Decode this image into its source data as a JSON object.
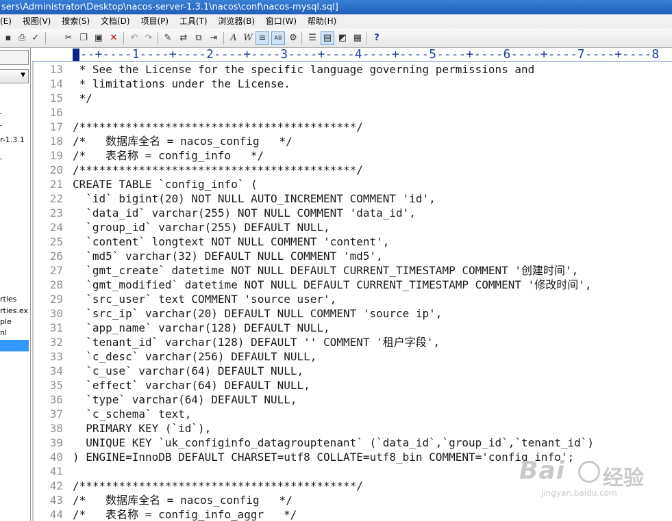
{
  "window": {
    "title": "sers\\Administrator\\Desktop\\nacos-server-1.3.1\\nacos\\conf\\nacos-mysql.sql]"
  },
  "menubar": {
    "items": [
      "(E)",
      "视图(V)",
      "搜索(S)",
      "文档(D)",
      "项目(P)",
      "工具(T)",
      "浏览器(B)",
      "窗口(W)",
      "帮助(H)"
    ]
  },
  "toolbar": {
    "icons": [
      "save-icon",
      "print-icon",
      "spellcheck-icon",
      "cut-icon",
      "copy-icon",
      "paste-icon",
      "delete-icon",
      "undo-icon",
      "redo-icon",
      "highlight-icon",
      "replace-icon",
      "copy-format-icon",
      "indent-icon",
      "font-icon",
      "word-wrap-icon",
      "line-numbers-icon",
      "case-icon",
      "settings-icon",
      "view-list-icon",
      "view-panel-icon",
      "view-output-icon",
      "view-browser-icon",
      "help-icon"
    ],
    "active": [
      "line-numbers-icon",
      "case-icon"
    ]
  },
  "sidebar": {
    "partial_labels": [
      "r-1.3.1",
      "rties",
      "rties.ex",
      "ple",
      "nl"
    ]
  },
  "ruler": {
    "text": "---+----1----+----2----+----3----+----4----+----5----+----6----+----7----+----8"
  },
  "editor": {
    "lines": [
      {
        "num": "13",
        "text": " * See the License for the specific language governing permissions and"
      },
      {
        "num": "14",
        "text": " * limitations under the License."
      },
      {
        "num": "15",
        "text": " */"
      },
      {
        "num": "16",
        "text": ""
      },
      {
        "num": "17",
        "text": "/******************************************/"
      },
      {
        "num": "18",
        "text": "/*   数据库全名 = nacos_config   */"
      },
      {
        "num": "19",
        "text": "/*   表名称 = config_info   */"
      },
      {
        "num": "20",
        "text": "/******************************************/"
      },
      {
        "num": "21",
        "text": "CREATE TABLE `config_info` ("
      },
      {
        "num": "22",
        "text": "  `id` bigint(20) NOT NULL AUTO_INCREMENT COMMENT 'id',"
      },
      {
        "num": "23",
        "text": "  `data_id` varchar(255) NOT NULL COMMENT 'data_id',"
      },
      {
        "num": "24",
        "text": "  `group_id` varchar(255) DEFAULT NULL,"
      },
      {
        "num": "25",
        "text": "  `content` longtext NOT NULL COMMENT 'content',"
      },
      {
        "num": "26",
        "text": "  `md5` varchar(32) DEFAULT NULL COMMENT 'md5',"
      },
      {
        "num": "27",
        "text": "  `gmt_create` datetime NOT NULL DEFAULT CURRENT_TIMESTAMP COMMENT '创建时间',"
      },
      {
        "num": "28",
        "text": "  `gmt_modified` datetime NOT NULL DEFAULT CURRENT_TIMESTAMP COMMENT '修改时间',"
      },
      {
        "num": "29",
        "text": "  `src_user` text COMMENT 'source user',"
      },
      {
        "num": "30",
        "text": "  `src_ip` varchar(20) DEFAULT NULL COMMENT 'source ip',"
      },
      {
        "num": "31",
        "text": "  `app_name` varchar(128) DEFAULT NULL,"
      },
      {
        "num": "32",
        "text": "  `tenant_id` varchar(128) DEFAULT '' COMMENT '租户字段',"
      },
      {
        "num": "33",
        "text": "  `c_desc` varchar(256) DEFAULT NULL,"
      },
      {
        "num": "34",
        "text": "  `c_use` varchar(64) DEFAULT NULL,"
      },
      {
        "num": "35",
        "text": "  `effect` varchar(64) DEFAULT NULL,"
      },
      {
        "num": "36",
        "text": "  `type` varchar(64) DEFAULT NULL,"
      },
      {
        "num": "37",
        "text": "  `c_schema` text,"
      },
      {
        "num": "38",
        "text": "  PRIMARY KEY (`id`),"
      },
      {
        "num": "39",
        "text": "  UNIQUE KEY `uk_configinfo_datagrouptenant` (`data_id`,`group_id`,`tenant_id`)"
      },
      {
        "num": "40",
        "text": ") ENGINE=InnoDB DEFAULT CHARSET=utf8 COLLATE=utf8_bin COMMENT='config_info';"
      },
      {
        "num": "41",
        "text": ""
      },
      {
        "num": "42",
        "text": "/******************************************/"
      },
      {
        "num": "43",
        "text": "/*   数据库全名 = nacos_config   */"
      },
      {
        "num": "44",
        "text": "/*   表名称 = config_info_aggr   */"
      }
    ]
  },
  "watermark": {
    "brand": "Bai",
    "suffix": "经验",
    "url": "jingyan.baidu.com"
  },
  "colors": {
    "title_bar": "#2a6cc8",
    "ruler_text": "#1a3ea8",
    "selection": "#3399ff",
    "line_number": "#909090"
  }
}
